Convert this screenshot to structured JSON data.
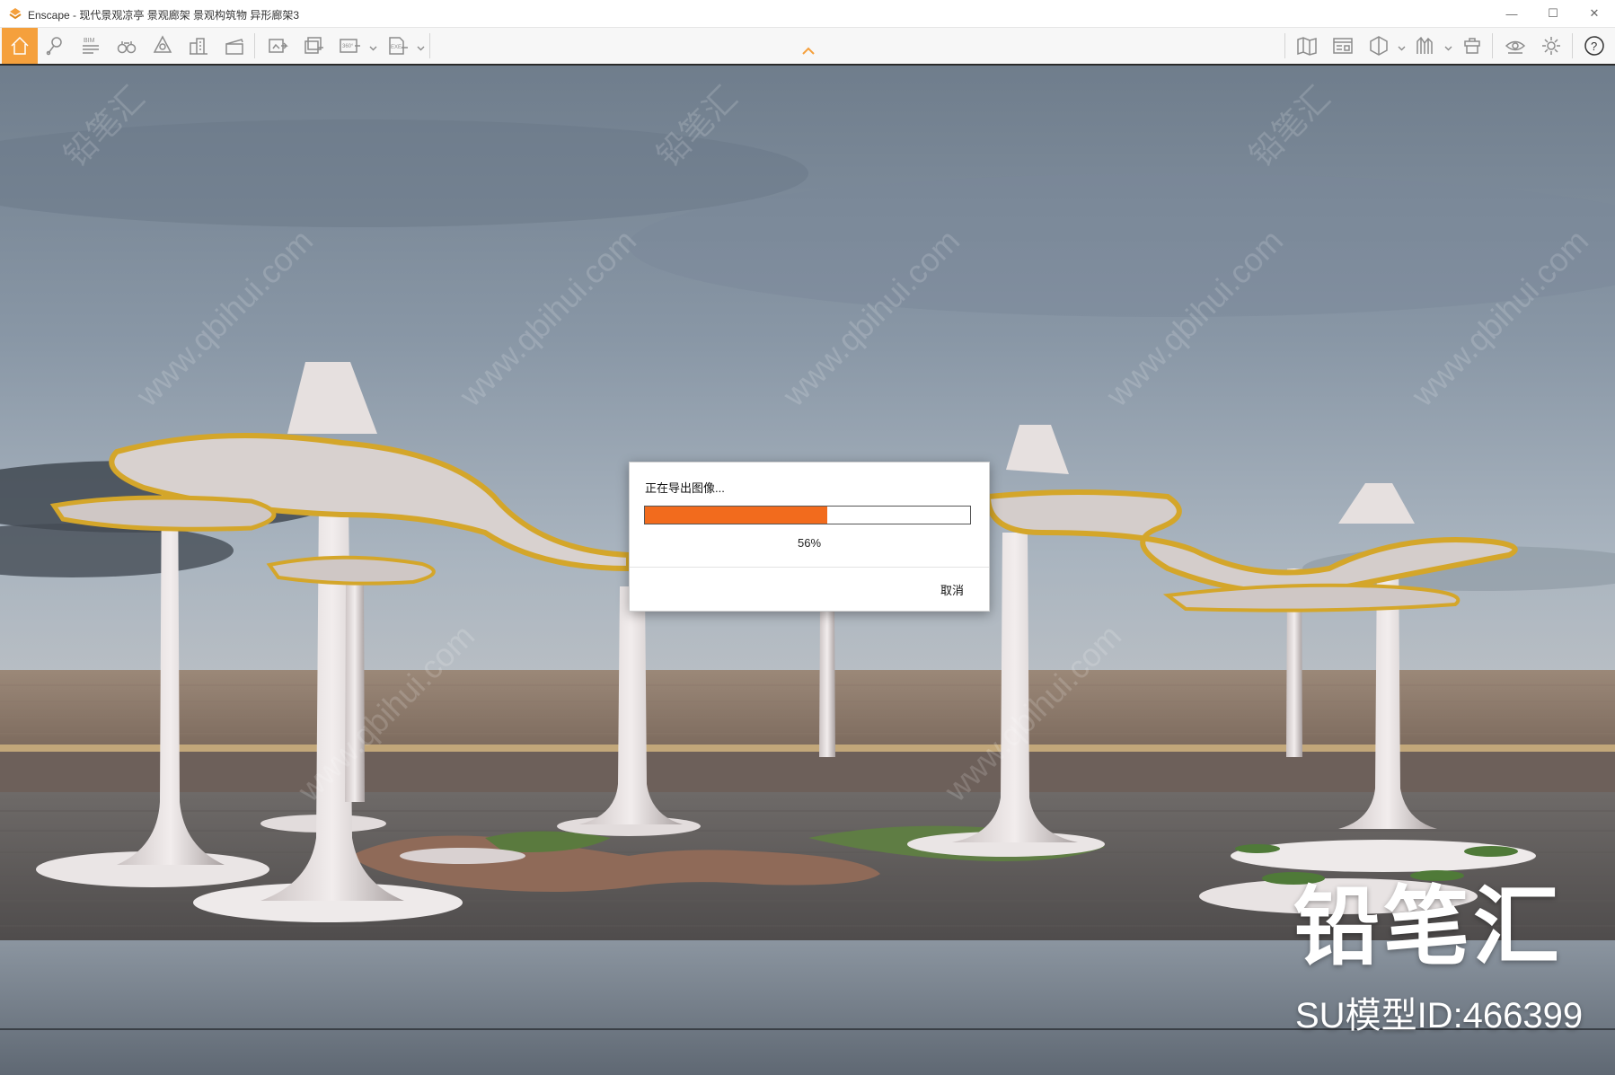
{
  "window": {
    "title": "Enscape - 现代景观凉亭 景观廊架 景观构筑物 异形廊架3",
    "minimize": "—",
    "maximize": "☐",
    "close": "✕"
  },
  "toolbar": {
    "bim_label": "BIM",
    "panorama_label": "360°",
    "exe_label": "EXE",
    "help_label": "?",
    "accent_color": "#f5a03c",
    "icons_left": [
      "home-icon",
      "map-pin-icon",
      "bim-list-icon",
      "binoculars-icon",
      "atmosphere-icon",
      "buildings-icon",
      "clapper-icon",
      "screenshot-export-icon",
      "batch-render-icon",
      "panorama-icon",
      "exe-export-icon"
    ],
    "icons_right": [
      "map-icon",
      "info-panel-icon",
      "view-cube-icon",
      "chart-icon",
      "asset-library-icon",
      "eye-icon",
      "gear-icon",
      "help-icon"
    ]
  },
  "dialog": {
    "title": "正在导出图像...",
    "progress_percent": 56,
    "progress_text": "56%",
    "cancel_label": "取消",
    "progress_color": "#f26b1d"
  },
  "watermark": {
    "brand": "铅笔汇",
    "model_id": "SU模型ID:466399",
    "site": "www.qbihui.com"
  }
}
